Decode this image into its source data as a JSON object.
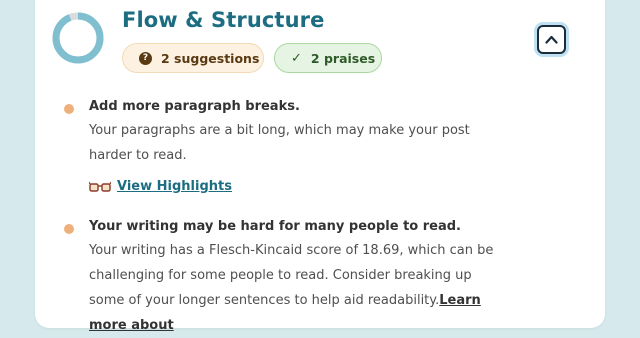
{
  "section": {
    "title": "Flow & Structure",
    "suggestions_badge": "2 suggestions",
    "praises_badge": "2 praises",
    "progress_fraction": 0.06,
    "colors": {
      "title": "#1d6d82",
      "ring": "#7fbfd0",
      "ring_track": "#d9dde0",
      "bullet": "#eeb07a"
    }
  },
  "icons": {
    "suggestion_icon": "question-circle-icon",
    "praise_icon": "check-icon",
    "collapse_icon": "chevron-up-icon",
    "highlight_icon": "glasses-icon"
  },
  "suggestions": [
    {
      "title": "Add more paragraph breaks.",
      "body": "Your paragraphs are a bit long, which may make your post harder to read.",
      "link_label": "View Highlights"
    },
    {
      "title": "Your writing may be hard for many people to read.",
      "body": "Your writing has a Flesch-Kincaid score of 18.69, which can be challenging for some people to read. Consider breaking up some of your longer sentences to help aid readability.",
      "link_label": "Learn more about"
    }
  ]
}
